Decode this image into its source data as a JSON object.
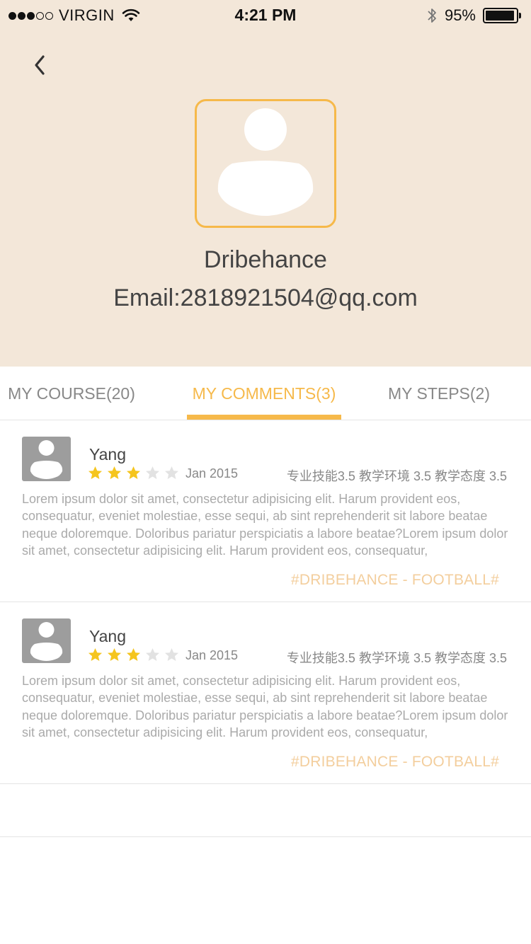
{
  "status_bar": {
    "carrier": "VIRGIN",
    "time": "4:21 PM",
    "battery_percent": "95%",
    "battery_level": 0.95,
    "signal_bars_filled": 3,
    "signal_bars_total": 5
  },
  "icons": {
    "back": "chevron-left-icon",
    "wifi": "wifi-icon",
    "bluetooth": "bluetooth-icon",
    "star": "star-icon",
    "avatar": "user-silhouette-icon"
  },
  "profile": {
    "name": "Dribehance",
    "email": "Email:2818921504@qq.com"
  },
  "tabs": [
    {
      "label": "MY COURSE(20)",
      "active": false
    },
    {
      "label": "MY COMMENTS(3)",
      "active": true
    },
    {
      "label": "MY STEPS(2)",
      "active": false
    }
  ],
  "comments": [
    {
      "author": "Yang",
      "rating": 3,
      "rating_max": 5,
      "date": "Jan 2015",
      "scores": "专业技能3.5 教学环境 3.5 教学态度 3.5",
      "text": "Lorem ipsum dolor sit amet, consectetur adipisicing elit. Harum provident eos, consequatur, eveniet molestiae, esse sequi, ab sint reprehenderit sit labore beatae neque doloremque. Doloribus pariatur perspiciatis a labore beatae?Lorem ipsum dolor sit amet, consectetur adipisicing elit. Harum provident eos, consequatur,",
      "tag": "#DRIBEHANCE - FOOTBALL#"
    },
    {
      "author": "Yang",
      "rating": 3,
      "rating_max": 5,
      "date": "Jan 2015",
      "scores": "专业技能3.5 教学环境 3.5 教学态度 3.5",
      "text": "Lorem ipsum dolor sit amet, consectetur adipisicing elit. Harum provident eos, consequatur, eveniet molestiae, esse sequi, ab sint reprehenderit sit labore beatae neque doloremque. Doloribus pariatur perspiciatis a labore beatae?Lorem ipsum dolor sit amet, consectetur adipisicing elit. Harum provident eos, consequatur,",
      "tag": "#DRIBEHANCE - FOOTBALL#"
    }
  ],
  "colors": {
    "header_bg": "#f3e7d9",
    "accent": "#f6b94a",
    "tag": "#f3ce9d",
    "star_filled": "#f5c51e",
    "star_empty": "#e2e2e2",
    "avatar_gray": "#9d9d9d"
  }
}
